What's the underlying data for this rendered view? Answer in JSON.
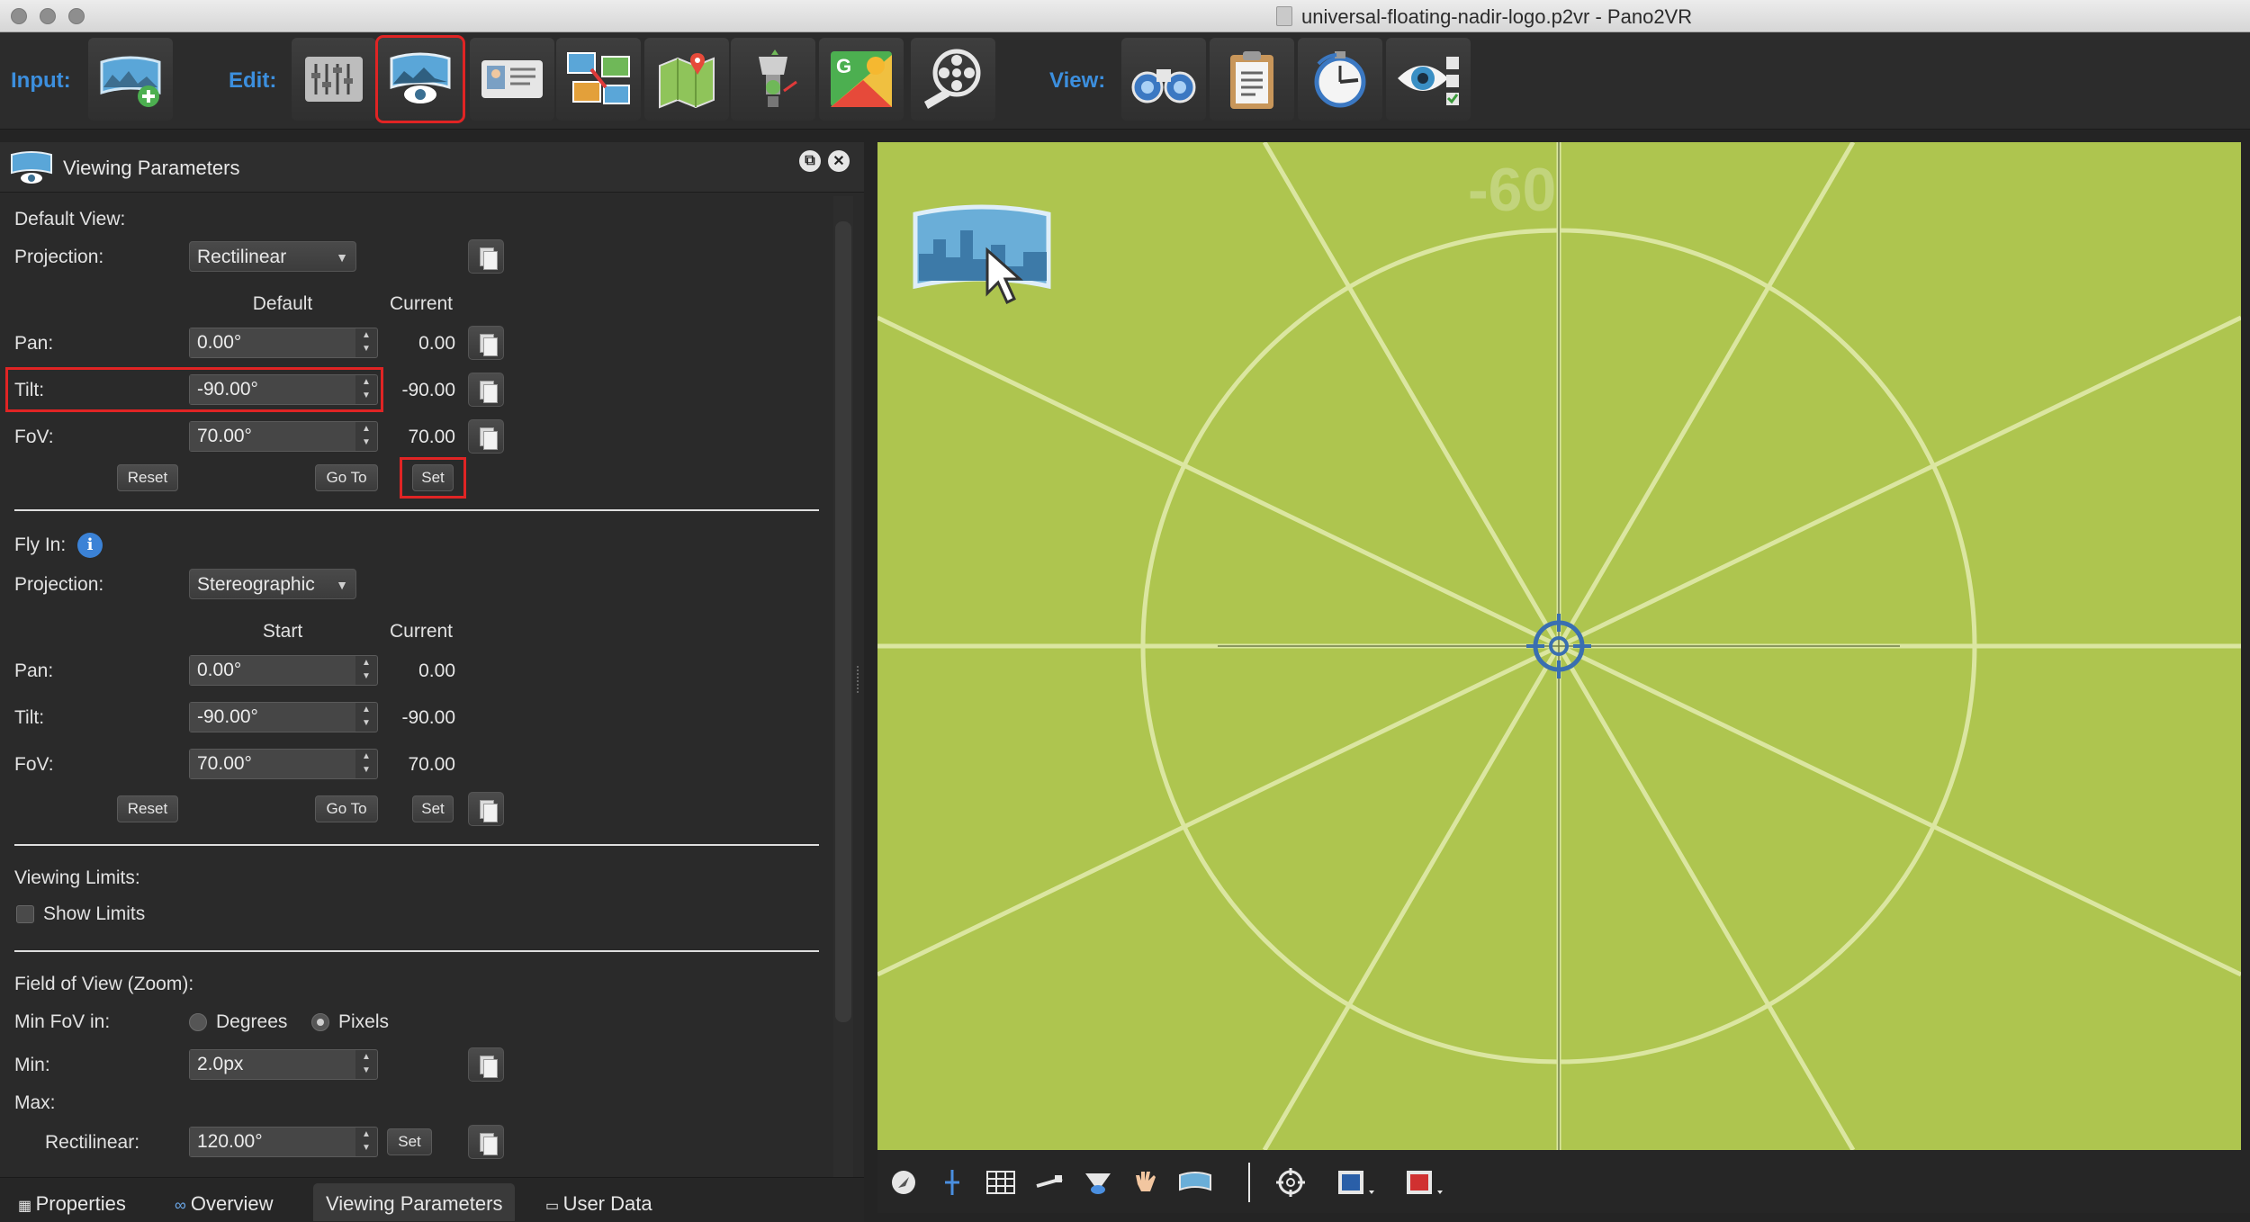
{
  "window": {
    "title": "universal-floating-nadir-logo.p2vr - Pano2VR"
  },
  "toolbar": {
    "input_label": "Input:",
    "edit_label": "Edit:",
    "view_label": "View:",
    "input_buttons": [
      "add-panorama-icon"
    ],
    "edit_buttons": [
      "properties-sliders-icon",
      "viewing-parameters-icon",
      "user-data-card-icon",
      "tour-browser-icon",
      "maps-icon",
      "patches-icon",
      "google-street-view-icon",
      "animation-film-icon"
    ],
    "view_buttons": [
      "binoculars-icon",
      "clipboard-icon",
      "stopwatch-icon",
      "eye-check-icon"
    ]
  },
  "panel": {
    "title": "Viewing Parameters",
    "default_view": {
      "heading": "Default View:",
      "projection_label": "Projection:",
      "projection_value": "Rectilinear",
      "col_default": "Default",
      "col_current": "Current",
      "pan_label": "Pan:",
      "pan_value": "0.00°",
      "pan_current": "0.00",
      "tilt_label": "Tilt:",
      "tilt_value": "-90.00°",
      "tilt_current": "-90.00",
      "fov_label": "FoV:",
      "fov_value": "70.00°",
      "fov_current": "70.00",
      "reset": "Reset",
      "goto": "Go To",
      "set": "Set"
    },
    "fly_in": {
      "heading": "Fly In:",
      "projection_label": "Projection:",
      "projection_value": "Stereographic",
      "col_start": "Start",
      "col_current": "Current",
      "pan_label": "Pan:",
      "pan_value": "0.00°",
      "pan_current": "0.00",
      "tilt_label": "Tilt:",
      "tilt_value": "-90.00°",
      "tilt_current": "-90.00",
      "fov_label": "FoV:",
      "fov_value": "70.00°",
      "fov_current": "70.00",
      "reset": "Reset",
      "goto": "Go To",
      "set": "Set"
    },
    "viewing_limits": {
      "heading": "Viewing Limits:",
      "show_limits": "Show Limits",
      "show_limits_checked": false
    },
    "fov_zoom": {
      "heading": "Field of View (Zoom):",
      "min_fov_in_label": "Min FoV in:",
      "degrees": "Degrees",
      "pixels": "Pixels",
      "selected": "Pixels",
      "min_label": "Min:",
      "min_value": "2.0px",
      "max_label": "Max:",
      "rectilinear_label": "Rectilinear:",
      "rectilinear_value": "120.00°",
      "set": "Set"
    }
  },
  "tabs": [
    {
      "label": "Properties",
      "icon": "properties-tab-icon",
      "active": false
    },
    {
      "label": "Overview",
      "icon": "binoculars-tab-icon",
      "active": false
    },
    {
      "label": "Viewing Parameters",
      "active": true
    },
    {
      "label": "User Data",
      "icon": "user-data-tab-icon",
      "active": false
    }
  ],
  "viewer": {
    "overlay_text": "-60",
    "background_color": "#aec54f",
    "tools": [
      "compass-icon",
      "crosshair-line-icon",
      "grid-icon",
      "measure-icon",
      "nadir-icon",
      "hand-icon",
      "panorama-icon",
      "target-icon",
      "color-blue-icon",
      "color-red-icon"
    ]
  }
}
